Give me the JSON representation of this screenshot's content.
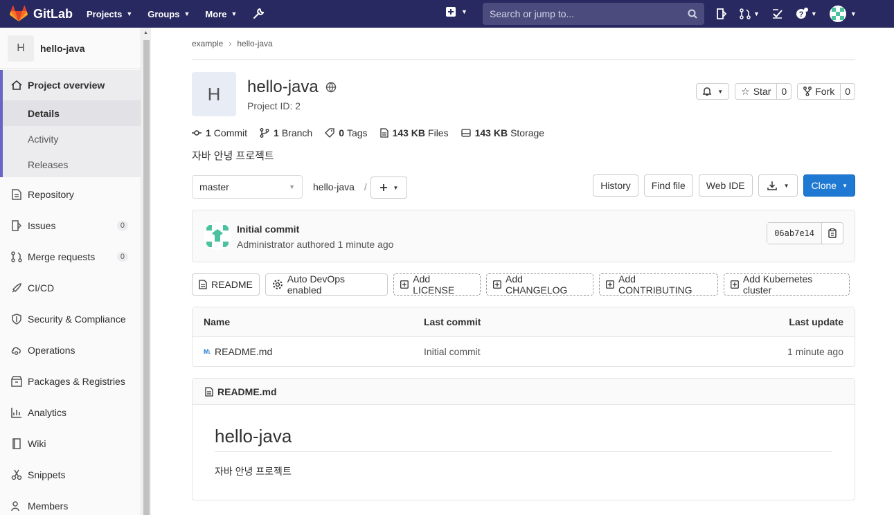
{
  "navbar": {
    "brand": "GitLab",
    "menu": [
      {
        "label": "Projects"
      },
      {
        "label": "Groups"
      },
      {
        "label": "More"
      }
    ],
    "search_placeholder": "Search or jump to..."
  },
  "sidebar": {
    "project_avatar": "H",
    "project_name": "hello-java",
    "overview": {
      "label": "Project overview",
      "subitems": [
        "Details",
        "Activity",
        "Releases"
      ]
    },
    "items": [
      {
        "label": "Repository",
        "icon": "document-icon"
      },
      {
        "label": "Issues",
        "icon": "issues-icon",
        "count": "0"
      },
      {
        "label": "Merge requests",
        "icon": "merge-request-icon",
        "count": "0"
      },
      {
        "label": "CI/CD",
        "icon": "rocket-icon"
      },
      {
        "label": "Security & Compliance",
        "icon": "shield-icon"
      },
      {
        "label": "Operations",
        "icon": "cloud-gear-icon"
      },
      {
        "label": "Packages & Registries",
        "icon": "package-icon"
      },
      {
        "label": "Analytics",
        "icon": "chart-icon"
      },
      {
        "label": "Wiki",
        "icon": "book-icon"
      },
      {
        "label": "Snippets",
        "icon": "scissors-icon"
      },
      {
        "label": "Members",
        "icon": "users-icon"
      }
    ]
  },
  "breadcrumb": [
    "example",
    "hello-java"
  ],
  "project": {
    "avatar": "H",
    "name": "hello-java",
    "id_text": "Project ID: 2",
    "star_label": "Star",
    "star_count": "0",
    "fork_label": "Fork",
    "fork_count": "0",
    "description": "자바 안녕 프로젝트"
  },
  "stats": [
    {
      "value": "1",
      "label": "Commit",
      "icon": "commit-icon"
    },
    {
      "value": "1",
      "label": "Branch",
      "icon": "branch-icon"
    },
    {
      "value": "0",
      "label": "Tags",
      "icon": "tag-icon"
    },
    {
      "value": "143 KB",
      "label": "Files",
      "icon": "file-icon"
    },
    {
      "value": "143 KB",
      "label": "Storage",
      "icon": "storage-icon"
    }
  ],
  "toolbar": {
    "branch": "master",
    "path": "hello-java",
    "path_sep": "/",
    "history": "History",
    "find_file": "Find file",
    "web_ide": "Web IDE",
    "clone": "Clone"
  },
  "commit": {
    "title": "Initial commit",
    "author": "Administrator",
    "meta": "authored 1 minute ago",
    "sha": "06ab7e14"
  },
  "quick_links": [
    {
      "label": "README",
      "style": "solid",
      "icon": "document-icon"
    },
    {
      "label": "Auto DevOps enabled",
      "style": "solid",
      "icon": "settings-icon"
    },
    {
      "label": "Add LICENSE",
      "style": "dashed",
      "icon": "plus-square-icon"
    },
    {
      "label": "Add CHANGELOG",
      "style": "dashed",
      "icon": "plus-square-icon"
    },
    {
      "label": "Add CONTRIBUTING",
      "style": "dashed",
      "icon": "plus-square-icon"
    },
    {
      "label": "Add Kubernetes cluster",
      "style": "dashed",
      "icon": "plus-square-icon"
    }
  ],
  "file_table": {
    "headers": [
      "Name",
      "Last commit",
      "Last update"
    ],
    "rows": [
      {
        "name": "README.md",
        "commit": "Initial commit",
        "updated": "1 minute ago"
      }
    ]
  },
  "readme": {
    "filename": "README.md",
    "heading": "hello-java",
    "body": "자바 안녕 프로젝트"
  },
  "colors": {
    "navbar": "#292961",
    "primary": "#1f78d1",
    "sidebar_active": "#6666c4"
  }
}
